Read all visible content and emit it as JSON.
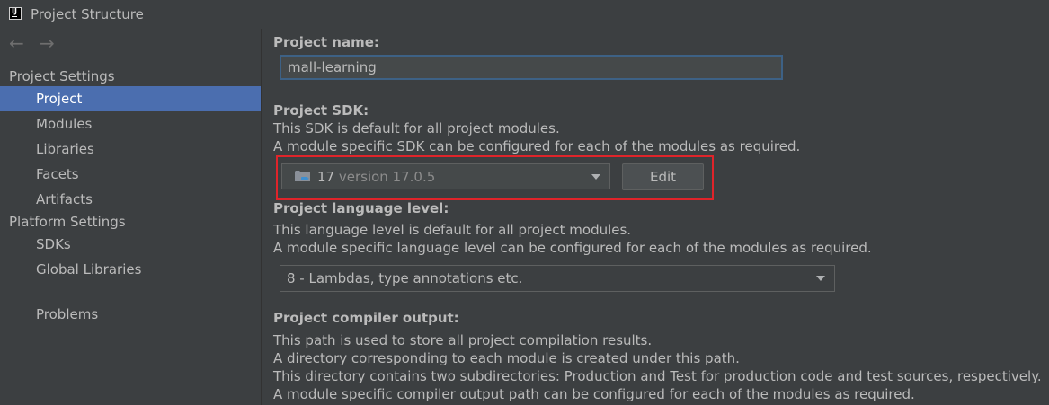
{
  "window": {
    "title": "Project Structure",
    "back_glyph": "←",
    "forward_glyph": "→"
  },
  "sidebar": {
    "groups": [
      {
        "header": "Project Settings",
        "items": [
          "Project",
          "Modules",
          "Libraries",
          "Facets",
          "Artifacts"
        ]
      },
      {
        "header": "Platform Settings",
        "items": [
          "SDKs",
          "Global Libraries"
        ]
      }
    ],
    "problems": "Problems",
    "selected": "Project"
  },
  "main": {
    "name": {
      "label": "Project name:",
      "value": "mall-learning"
    },
    "sdk": {
      "label": "Project SDK:",
      "desc1": "This SDK is default for all project modules.",
      "desc2": "A module specific SDK can be configured for each of the modules as required.",
      "selected_name": "17",
      "selected_version": "version 17.0.5",
      "edit_label": "Edit",
      "icon": "folder-with-java-cup-icon"
    },
    "language": {
      "label": "Project language level:",
      "desc1": "This language level is default for all project modules.",
      "desc2": "A module specific language level can be configured for each of the modules as required.",
      "selected": "8 - Lambdas, type annotations etc."
    },
    "compiler": {
      "label": "Project compiler output:",
      "desc1": "This path is used to store all project compilation results.",
      "desc2": "A directory corresponding to each module is created under this path.",
      "desc3": "This directory contains two subdirectories: Production and Test for production code and test sources, respectively.",
      "desc4": "A module specific compiler output path can be configured for each of the modules as required."
    }
  },
  "colors": {
    "background": "#3c3f41",
    "selection": "#4b6eaf",
    "focus_border": "#3d6185",
    "highlight": "#e0242a",
    "text": "#bbbbbb"
  }
}
